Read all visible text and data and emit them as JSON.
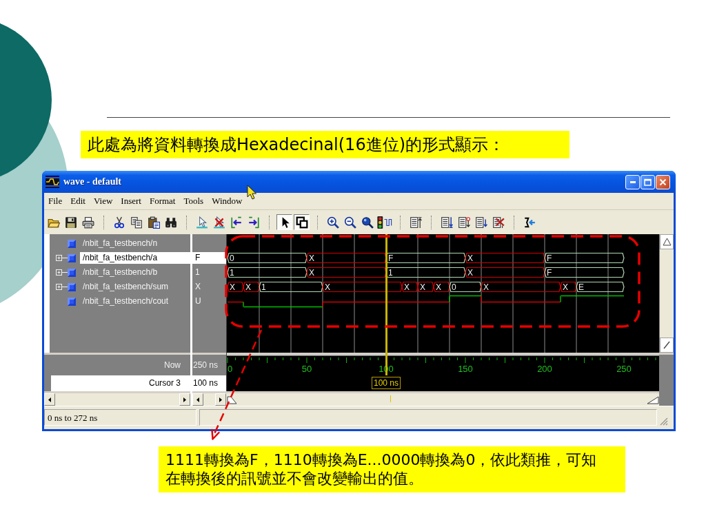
{
  "heading_callout": {
    "text": "此處為將資料轉換成Hexadecinal(16進位)的形式顯示："
  },
  "window": {
    "title": "wave - default",
    "menu": [
      "File",
      "Edit",
      "View",
      "Insert",
      "Format",
      "Tools",
      "Window"
    ],
    "toolbar": [
      [
        {
          "kind": "open",
          "pressed": false
        },
        {
          "kind": "save",
          "pressed": false
        },
        {
          "kind": "print",
          "pressed": false
        }
      ],
      [
        {
          "kind": "cut",
          "pressed": false
        },
        {
          "kind": "copy",
          "pressed": false
        },
        {
          "kind": "paste",
          "pressed": false
        },
        {
          "kind": "find",
          "pressed": false
        }
      ],
      [
        {
          "kind": "add_cursor",
          "pressed": false
        },
        {
          "kind": "delete_cursor",
          "pressed": false
        },
        {
          "kind": "cursor_prev",
          "pressed": false
        },
        {
          "kind": "cursor_next",
          "pressed": false
        }
      ],
      [
        {
          "kind": "select_mode",
          "pressed": true
        },
        {
          "kind": "zoom_mode",
          "pressed": true
        }
      ],
      [
        {
          "kind": "zoom_in",
          "pressed": false
        },
        {
          "kind": "zoom_out",
          "pressed": false
        },
        {
          "kind": "zoom_full",
          "pressed": false
        },
        {
          "kind": "break",
          "pressed": false
        }
      ],
      [
        {
          "kind": "list_top",
          "pressed": false
        }
      ],
      [
        {
          "kind": "list_down",
          "pressed": false
        },
        {
          "kind": "list_mark",
          "pressed": false
        },
        {
          "kind": "list_next",
          "pressed": false
        },
        {
          "kind": "list_delete",
          "pressed": false
        }
      ],
      [
        {
          "kind": "connect",
          "pressed": false
        }
      ]
    ],
    "signals": [
      {
        "name": "/nbit_fa_testbench/n",
        "expandable": false,
        "selected": false
      },
      {
        "name": "/nbit_fa_testbench/a",
        "expandable": true,
        "selected": true,
        "value": "F",
        "wave": {
          "kind": "bus",
          "segments": [
            {
              "value": "0",
              "kind": "valid"
            },
            {
              "value": "X",
              "kind": "unknown"
            },
            {
              "value": "F",
              "kind": "valid"
            },
            {
              "value": "X",
              "kind": "unknown"
            },
            {
              "value": "F",
              "kind": "valid"
            }
          ]
        }
      },
      {
        "name": "/nbit_fa_testbench/b",
        "expandable": true,
        "selected": false,
        "value": "1",
        "wave": {
          "kind": "bus",
          "segments": [
            {
              "value": "1",
              "kind": "valid"
            },
            {
              "value": "X",
              "kind": "unknown"
            },
            {
              "value": "1",
              "kind": "valid"
            },
            {
              "value": "X",
              "kind": "unknown"
            },
            {
              "value": "F",
              "kind": "valid"
            }
          ]
        }
      },
      {
        "name": "/nbit_fa_testbench/sum",
        "expandable": true,
        "selected": false,
        "value": "X",
        "wave": {
          "kind": "bus",
          "segments": [
            {
              "value": "X",
              "kind": "unknown"
            },
            {
              "value": "X",
              "kind": "unknown"
            },
            {
              "value": "1",
              "kind": "valid"
            },
            {
              "value": "X",
              "kind": "unknown"
            },
            {
              "value": "X",
              "kind": "unknown"
            },
            {
              "value": "X",
              "kind": "unknown"
            },
            {
              "value": "X",
              "kind": "unknown"
            },
            {
              "value": "0",
              "kind": "valid"
            },
            {
              "value": "X",
              "kind": "unknown"
            },
            {
              "value": "X",
              "kind": "unknown"
            },
            {
              "value": "E",
              "kind": "valid"
            }
          ]
        }
      },
      {
        "name": "/nbit_fa_testbench/cout",
        "expandable": false,
        "selected": false,
        "value": "U",
        "wave": {
          "kind": "bit",
          "segments": [
            {
              "kind": "unknown"
            },
            {
              "kind": "low"
            },
            {
              "kind": "unknown"
            },
            {
              "kind": "high"
            },
            {
              "kind": "unknown"
            },
            {
              "kind": "high"
            }
          ]
        }
      }
    ],
    "now": {
      "label": "Now",
      "value": "250 ns"
    },
    "cursor": {
      "label": "Cursor 3",
      "value": "100 ns",
      "marker": "100 ns"
    },
    "time_labels": [
      "0",
      "50",
      "100",
      "150",
      "200",
      "250"
    ],
    "status_bar": [
      "0 ns to 272 ns"
    ]
  },
  "note_callout": {
    "lines": [
      "1111轉換為F，1110轉換為E...0000轉換為0，依此類推，可知",
      "在轉換後的訊號並不會改變輸出的值。"
    ]
  }
}
